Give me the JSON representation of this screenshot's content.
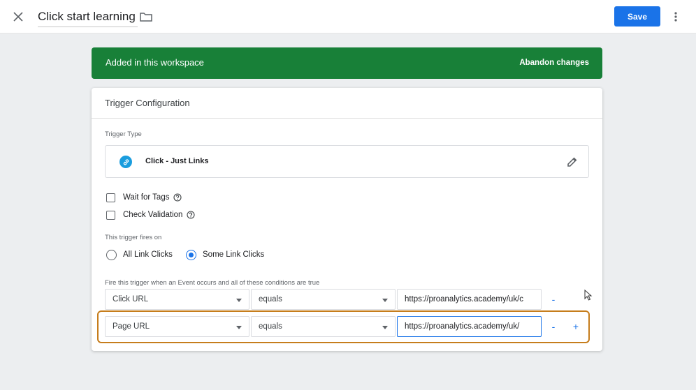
{
  "topbar": {
    "title": "Click start learning",
    "save_label": "Save"
  },
  "banner": {
    "text": "Added in this workspace",
    "action": "Abandon changes",
    "color": "#188038"
  },
  "config": {
    "title": "Trigger Configuration",
    "trigger_type_label": "Trigger Type",
    "trigger_type_value": "Click - Just Links",
    "wait_for_tags": "Wait for Tags",
    "check_validation": "Check Validation",
    "fires_on_label": "This trigger fires on",
    "radio_all": "All Link Clicks",
    "radio_some": "Some Link Clicks",
    "selected_radio": "Some Link Clicks",
    "conditions_label": "Fire this trigger when an Event occurs and all of these conditions are true",
    "conditions": [
      {
        "variable": "Click URL",
        "operator": "equals",
        "value": "https://proanalytics.academy/uk/c",
        "remove": "-"
      },
      {
        "variable": "Page URL",
        "operator": "equals",
        "value": "https://proanalytics.academy/uk/",
        "remove": "-",
        "add": "+"
      }
    ]
  },
  "icons": {
    "close": "close-icon",
    "folder": "folder-icon",
    "more": "more-vert-icon",
    "link": "link-icon",
    "edit": "pencil-icon",
    "help": "help-circle-icon"
  },
  "colors": {
    "accent": "#1a73e8",
    "highlight": "#c67d1c"
  }
}
